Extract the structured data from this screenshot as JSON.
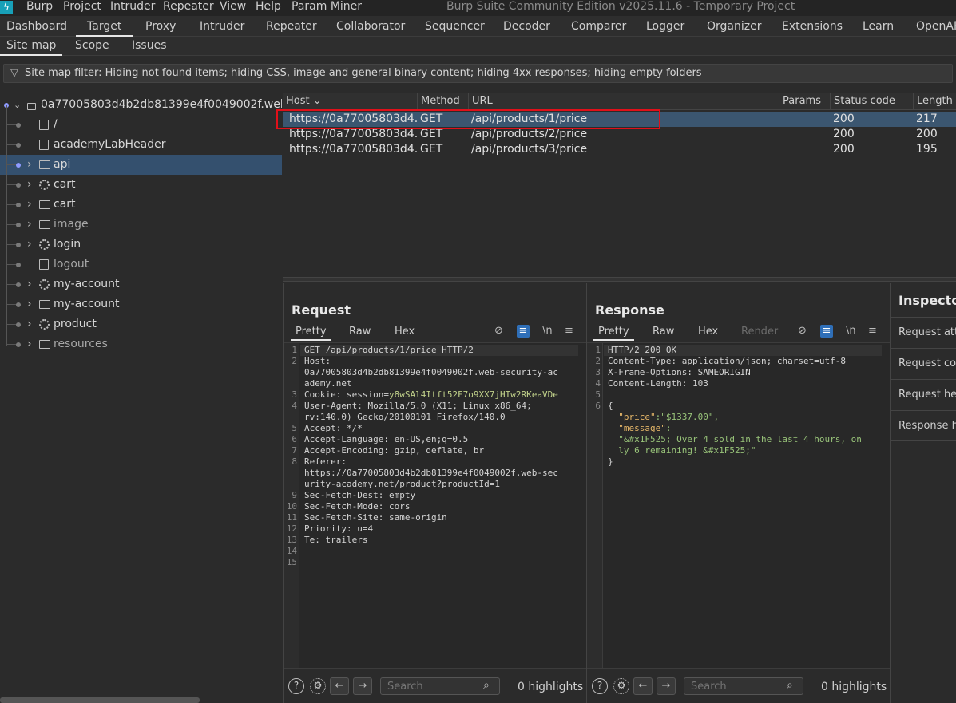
{
  "app": {
    "title": "Burp Suite Community Edition v2025.11.6 - Temporary Project",
    "menu": [
      "Burp",
      "Project",
      "Intruder",
      "Repeater",
      "View",
      "Help",
      "Param Miner"
    ]
  },
  "main_tabs": [
    "Dashboard",
    "Target",
    "Proxy",
    "Intruder",
    "Repeater",
    "Collaborator",
    "Sequencer",
    "Decoder",
    "Comparer",
    "Logger",
    "Organizer",
    "Extensions",
    "Learn",
    "OpenAPI"
  ],
  "sub_tabs": [
    "Site map",
    "Scope",
    "Issues"
  ],
  "filter": "Site map filter: Hiding not found items;  hiding CSS, image and general binary content;  hiding 4xx responses;  hiding empty folders",
  "tree": {
    "root": "0a77005803d4b2db81399e4f0049002f.web-security-academy.net",
    "items": [
      {
        "label": "/",
        "icon": "file-icon"
      },
      {
        "label": "academyLabHeader",
        "icon": "file-icon"
      },
      {
        "label": "api",
        "icon": "folder-icon"
      },
      {
        "label": "cart",
        "icon": "gear-icon"
      },
      {
        "label": "cart",
        "icon": "folder-icon"
      },
      {
        "label": "image",
        "icon": "folder-icon"
      },
      {
        "label": "login",
        "icon": "gear-icon"
      },
      {
        "label": "logout",
        "icon": "file-icon"
      },
      {
        "label": "my-account",
        "icon": "gear-icon"
      },
      {
        "label": "my-account",
        "icon": "folder-icon"
      },
      {
        "label": "product",
        "icon": "gear-icon"
      },
      {
        "label": "resources",
        "icon": "folder-icon"
      }
    ]
  },
  "table": {
    "headers": [
      "Host",
      "Method",
      "URL",
      "Params",
      "Status code",
      "Length"
    ],
    "rows": [
      {
        "host": "https://0a77005803d4...",
        "method": "GET",
        "url": "/api/products/1/price",
        "params": "",
        "status": "200",
        "length": "217"
      },
      {
        "host": "https://0a77005803d4...",
        "method": "GET",
        "url": "/api/products/2/price",
        "params": "",
        "status": "200",
        "length": "200"
      },
      {
        "host": "https://0a77005803d4...",
        "method": "GET",
        "url": "/api/products/3/price",
        "params": "",
        "status": "200",
        "length": "195"
      }
    ]
  },
  "request": {
    "title": "Request",
    "tabs": [
      "Pretty",
      "Raw",
      "Hex"
    ],
    "lines": [
      {
        "n": "1",
        "h": "GET /api/products/1/price HTTP/2",
        "v": ""
      },
      {
        "n": "2",
        "h": "Host:",
        "v": ""
      },
      {
        "n": "",
        "h": "0a77005803d4b2db81399e4f0049002f.web-security-ac",
        "v": ""
      },
      {
        "n": "",
        "h": "ademy.net",
        "v": ""
      },
      {
        "n": "3",
        "h": "Cookie: session=",
        "v": "y8wSAl4Itft52F7o9XX7jHTw2RKeaVDe"
      },
      {
        "n": "4",
        "h": "User-Agent: Mozilla/5.0 (X11; Linux x86_64;",
        "v": ""
      },
      {
        "n": "",
        "h": "rv:140.0) Gecko/20100101 Firefox/140.0",
        "v": ""
      },
      {
        "n": "5",
        "h": "Accept: */*",
        "v": ""
      },
      {
        "n": "6",
        "h": "Accept-Language: en-US,en;q=0.5",
        "v": ""
      },
      {
        "n": "7",
        "h": "Accept-Encoding: gzip, deflate, br",
        "v": ""
      },
      {
        "n": "8",
        "h": "Referer:",
        "v": ""
      },
      {
        "n": "",
        "h": "https://0a77005803d4b2db81399e4f0049002f.web-sec",
        "v": ""
      },
      {
        "n": "",
        "h": "urity-academy.net/product?productId=1",
        "v": ""
      },
      {
        "n": "9",
        "h": "Sec-Fetch-Dest: empty",
        "v": ""
      },
      {
        "n": "10",
        "h": "Sec-Fetch-Mode: cors",
        "v": ""
      },
      {
        "n": "11",
        "h": "Sec-Fetch-Site: same-origin",
        "v": ""
      },
      {
        "n": "12",
        "h": "Priority: u=4",
        "v": ""
      },
      {
        "n": "13",
        "h": "Te: trailers",
        "v": ""
      },
      {
        "n": "14",
        "h": "",
        "v": ""
      },
      {
        "n": "15",
        "h": "",
        "v": ""
      }
    ],
    "search_placeholder": "Search",
    "highlights": "0 highlights"
  },
  "response": {
    "title": "Response",
    "tabs": [
      "Pretty",
      "Raw",
      "Hex",
      "Render"
    ],
    "lines": [
      {
        "n": "1",
        "h": "HTTP/2 200 OK",
        "k": "",
        "s": ""
      },
      {
        "n": "2",
        "h": "Content-Type: application/json; charset=utf-8",
        "k": "",
        "s": ""
      },
      {
        "n": "3",
        "h": "X-Frame-Options: SAMEORIGIN",
        "k": "",
        "s": ""
      },
      {
        "n": "4",
        "h": "Content-Length: 103",
        "k": "",
        "s": ""
      },
      {
        "n": "5",
        "h": "",
        "k": "",
        "s": ""
      },
      {
        "n": "6",
        "h": "{",
        "k": "",
        "s": ""
      },
      {
        "n": "",
        "h": "  ",
        "k": "\"price\"",
        "s": ":\"$1337.00\","
      },
      {
        "n": "",
        "h": "  ",
        "k": "\"message\"",
        "s": ":"
      },
      {
        "n": "",
        "h": "  ",
        "k": "",
        "s": "\"&#x1F525; Over 4 sold in the last 4 hours, on"
      },
      {
        "n": "",
        "h": "  ",
        "k": "",
        "s": "ly 6 remaining! &#x1F525;\""
      },
      {
        "n": "",
        "h": "}",
        "k": "",
        "s": ""
      }
    ],
    "search_placeholder": "Search",
    "highlights": "0 highlights"
  },
  "inspector": {
    "title": "Inspector",
    "sections": [
      "Request attributes",
      "Request cookies",
      "Request headers",
      "Response headers"
    ]
  },
  "colors": {
    "accent": "#2f6fb8",
    "selected_row": "#3b5670",
    "highlight_box": "#e0101a"
  }
}
